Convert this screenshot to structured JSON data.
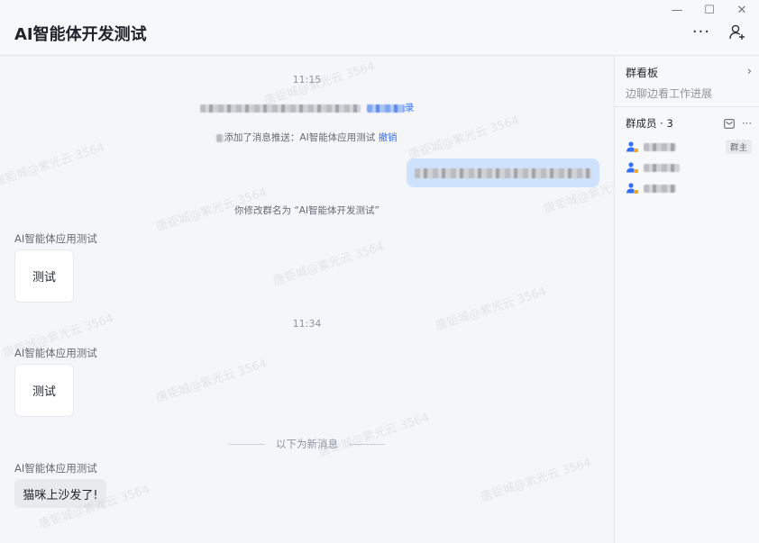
{
  "header": {
    "title": "AI智能体开发测试"
  },
  "window_controls": {
    "minimize": "—",
    "maximize": "☐",
    "close": "✕"
  },
  "messages": {
    "time_1": "11:15",
    "sys_1_link": "录",
    "sys_2_text": "添加了消息推送：AI智能体应用测试",
    "sys_2_link": "撤销",
    "sys_3": "你修改群名为 “AI智能体开发测试”",
    "msg_1_sender": "AI智能体应用测试",
    "msg_1_text": "测试",
    "time_2": "11:34",
    "msg_2_sender": "AI智能体应用测试",
    "msg_2_text": "测试",
    "divider": "以下为新消息",
    "msg_3_sender": "AI智能体应用测试",
    "msg_3_text": "猫咪上沙发了!"
  },
  "side": {
    "board_title": "群看板",
    "board_sub": "边聊边看工作进展",
    "members_title": "群成员 · 3",
    "owner_badge": "群主"
  },
  "watermark": "唐钜城@紫光云 3564",
  "colors": {
    "accent": "#3370ff",
    "my_bubble": "#cfe2fd",
    "background": "#f5f6f9"
  }
}
